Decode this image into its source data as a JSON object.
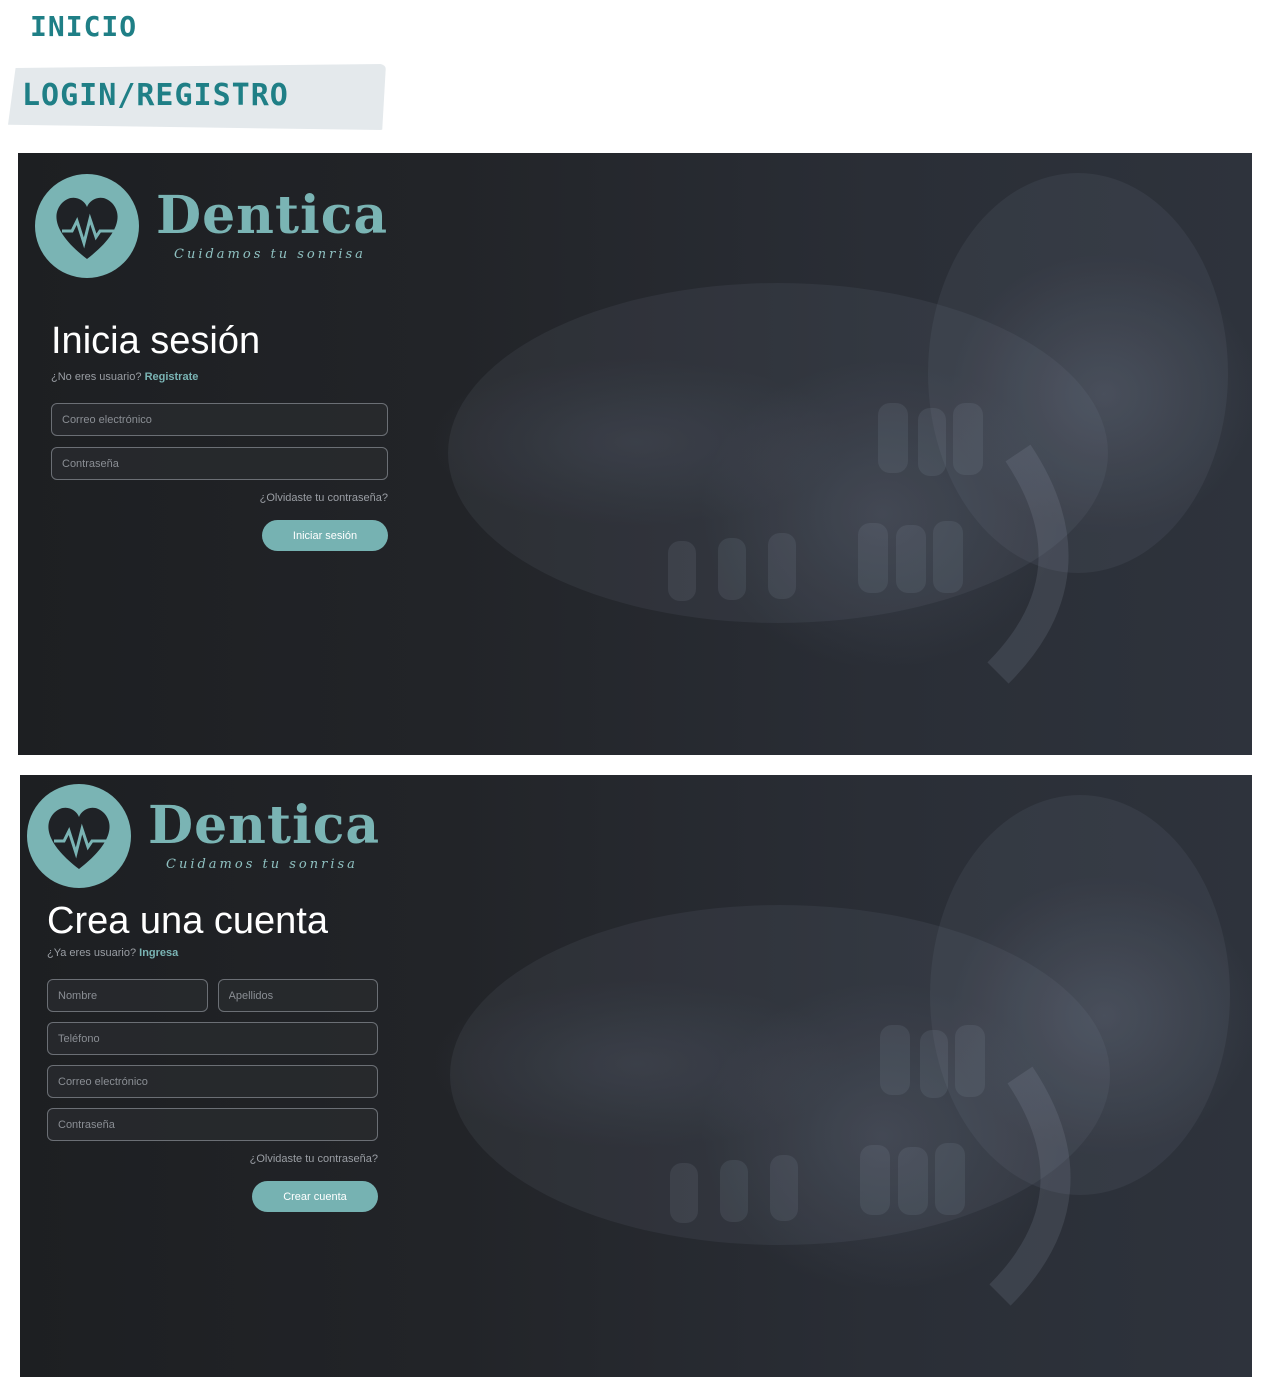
{
  "nav": {
    "inicio": "INICIO",
    "login_registro": "LOGIN/REGISTRO"
  },
  "brand": {
    "name": "Dentica",
    "tagline": "Cuidamos tu sonrisa",
    "accent_color": "#76b2b2"
  },
  "login": {
    "title": "Inicia sesión",
    "prompt": "¿No eres usuario?",
    "link": "Registrate",
    "email_placeholder": "Correo electrónico",
    "password_placeholder": "Contraseña",
    "forgot": "¿Olvidaste tu contraseña?",
    "submit": "Iniciar sesión"
  },
  "register": {
    "title": "Crea una cuenta",
    "prompt": "¿Ya eres usuario?",
    "link": "Ingresa",
    "name_placeholder": "Nombre",
    "lastname_placeholder": "Apellidos",
    "phone_placeholder": "Teléfono",
    "email_placeholder": "Correo electrónico",
    "password_placeholder": "Contraseña",
    "forgot": "¿Olvidaste tu contraseña?",
    "submit": "Crear cuenta"
  }
}
